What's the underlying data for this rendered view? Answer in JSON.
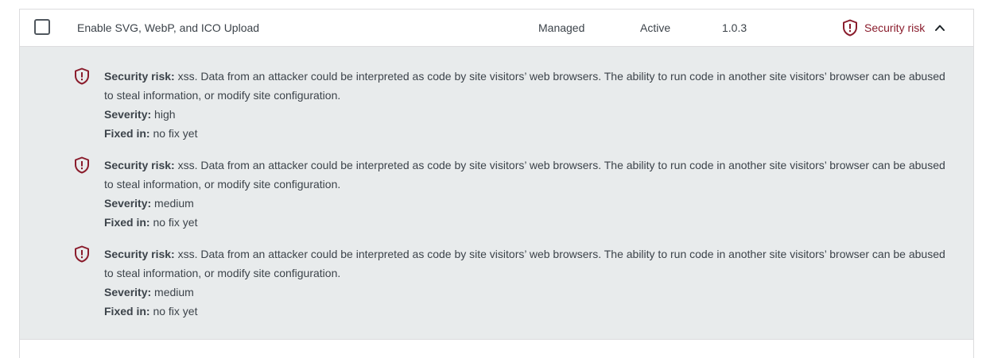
{
  "plugin": {
    "name": "Enable SVG, WebP, and ICO Upload",
    "managed": "Managed",
    "status": "Active",
    "version": "1.0.3",
    "risk_label": "Security risk"
  },
  "vulnerabilities": [
    {
      "risk_label": "Security risk:",
      "description": "xss. Data from an attacker could be interpreted as code by site visitors’ web browsers. The ability to run code in another site visitors’ browser can be abused to steal information, or modify site configuration.",
      "severity_label": "Severity:",
      "severity": "high",
      "fixed_label": "Fixed in:",
      "fixed": "no fix yet"
    },
    {
      "risk_label": "Security risk:",
      "description": "xss. Data from an attacker could be interpreted as code by site visitors’ web browsers. The ability to run code in another site visitors’ browser can be abused to steal information, or modify site configuration.",
      "severity_label": "Severity:",
      "severity": "medium",
      "fixed_label": "Fixed in:",
      "fixed": "no fix yet"
    },
    {
      "risk_label": "Security risk:",
      "description": "xss. Data from an attacker could be interpreted as code by site visitors’ web browsers. The ability to run code in another site visitors’ browser can be abused to steal information, or modify site configuration.",
      "severity_label": "Severity:",
      "severity": "medium",
      "fixed_label": "Fixed in:",
      "fixed": "no fix yet"
    }
  ],
  "icons": {
    "risk": "shield-exclamation-icon",
    "toggle": "chevron-up-icon"
  },
  "colors": {
    "risk": "#8a1c2c",
    "details_bg": "#e8ebec",
    "text": "#3c434a"
  }
}
